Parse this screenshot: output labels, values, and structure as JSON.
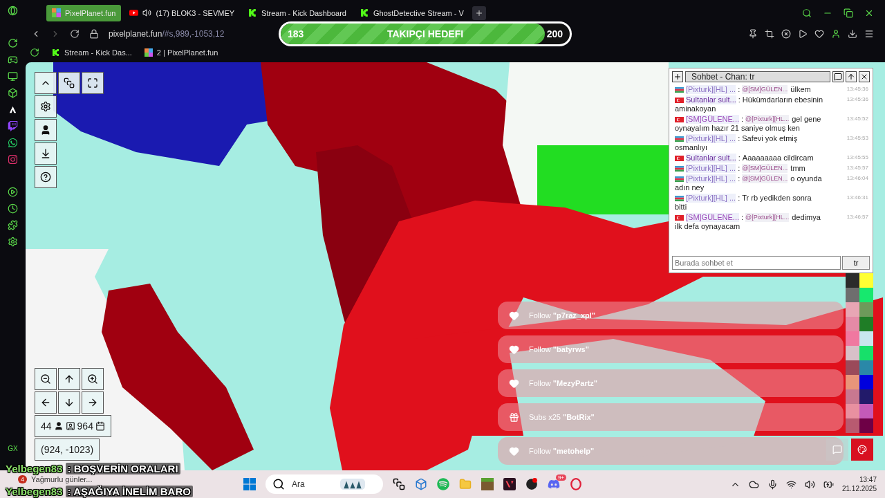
{
  "browser": {
    "tabs": [
      {
        "kind": "pixel",
        "label": "PixelPlanet.fun",
        "selected": true,
        "audio": false
      },
      {
        "kind": "youtube",
        "label": "(17) BLOK3 - SEVMEY",
        "selected": false,
        "audio": true
      },
      {
        "kind": "kick",
        "label": "Stream - Kick Dashboard",
        "selected": false,
        "audio": false
      },
      {
        "kind": "kick",
        "label": "GhostDetective Stream - V",
        "selected": false,
        "audio": false
      }
    ],
    "url_host": "pixelplanet.fun",
    "url_path": "/#s,989,-1053,12",
    "bookmarks": [
      {
        "kind": "kick",
        "label": "Stream - Kick Das..."
      },
      {
        "kind": "pixel",
        "label": "2 | PixelPlanet.fun"
      }
    ],
    "sidebar_label": "GX"
  },
  "goal": {
    "current": "183",
    "title": "TAKIPÇI HEDEFI",
    "target": "200",
    "level": 0.915
  },
  "map_controls": {
    "online": "44",
    "pixels": "964",
    "coordinates": "(924, -1023)"
  },
  "chat": {
    "title": "Sohbet - Chan: tr",
    "separator": ":",
    "placeholder": "Burada sohbet et",
    "channel": "tr",
    "messages": [
      {
        "kind": "az",
        "name": "[Pixturk][HL] ...",
        "color": "#8c72c4",
        "mention": "@[SM]GÜLEN...",
        "text": "ülkem",
        "time": "13:45:36"
      },
      {
        "kind": "tr",
        "name": "Sultanlar sult...",
        "color": "#6a2c9c",
        "text": "Hükümdarların ebesinin",
        "text_continued": "aminakoyan",
        "time": "13:45:36"
      },
      {
        "kind": "tr",
        "name": "[SM]GÜLENE...",
        "color": "#9a46b8",
        "mention": "@[Pixturk][HL...",
        "text": "gel gene",
        "text_continued": "oynayalım hazır 21 saniye olmuş ken",
        "time": "13:45:52"
      },
      {
        "kind": "az",
        "name": "[Pixturk][HL] ...",
        "color": "#8c72c4",
        "text": "Safevi yok etmiş",
        "text_continued": "osmanlıyı",
        "time": "13:45:53"
      },
      {
        "kind": "tr",
        "name": "Sultanlar sult...",
        "color": "#6a2c9c",
        "text": "Aaaaaaaaa cildircam",
        "time": "13:45:55"
      },
      {
        "kind": "az",
        "name": "[Pixturk][HL] ...",
        "color": "#8c72c4",
        "mention": "@[SM]GÜLEN...",
        "text": "tmm",
        "time": "13:45:57"
      },
      {
        "kind": "az",
        "name": "[Pixturk][HL] ...",
        "color": "#8c72c4",
        "mention": "@[SM]GÜLEN...",
        "text": "o oyunda",
        "text_continued": "adın ney",
        "time": "13:46:04"
      },
      {
        "kind": "az",
        "name": "[Pixturk][HL] ...",
        "color": "#8c72c4",
        "text": "Tr rb yedikden sonra",
        "text_continued": "bitti",
        "time": "13:46:31"
      },
      {
        "kind": "tr",
        "name": "[SM]GÜLENE...",
        "color": "#9a46b8",
        "mention": "@[Pixturk][HL...",
        "text": "dedimya",
        "text_continued": "ilk defa oynayacam",
        "time": "13:46:57"
      }
    ]
  },
  "palette": {
    "swatches": [
      {
        "color": "#2b2b2b"
      },
      {
        "color": "#ffff33"
      },
      {
        "color": "#6e6e6e"
      },
      {
        "color": "#17e86e"
      },
      {
        "color": "#e8a6b4"
      },
      {
        "color": "#6e9a5a"
      },
      {
        "color": "#e58aa6"
      },
      {
        "color": "#1f7d26"
      },
      {
        "color": "#f078a0"
      },
      {
        "color": "#c8e6ee"
      },
      {
        "color": "#d8c0c8"
      },
      {
        "color": "#17e06a"
      },
      {
        "color": "#9a4a5a"
      },
      {
        "color": "#2a88a8"
      },
      {
        "color": "#e8957a"
      },
      {
        "color": "#0000dd"
      },
      {
        "color": "#c87890"
      },
      {
        "color": "#221a6a"
      },
      {
        "color": "#e890a0"
      },
      {
        "color": "#c45ab8"
      },
      {
        "color": "#b85a70"
      },
      {
        "color": "#6e0046"
      }
    ]
  },
  "alerts": [
    {
      "kind": "follow",
      "text": "Follow **\"p7raz_xpl\"**"
    },
    {
      "kind": "follow",
      "text": "Follow **\"batyrws\"**"
    },
    {
      "kind": "follow",
      "text": "Follow **\"MezyPartz\"**"
    },
    {
      "kind": "sub",
      "text": "Subs x25 **\"BotRix\"**"
    },
    {
      "kind": "follow",
      "text": "Follow **\"metohelp\"**"
    }
  ],
  "stream_chat": [
    {
      "user": "Yelbegen83",
      "text": ": BOŞVERİN ORALARI"
    },
    {
      "user": "Yelbegen83",
      "text": ": AŞAĞIYA İNELİM BARO"
    }
  ],
  "taskbar": {
    "weather_badge": "4",
    "weather": "Yağmurlu günler...",
    "search_placeholder": "Ara",
    "discord_badge": "9+",
    "time": "13:47",
    "date": "21.12.2025"
  }
}
